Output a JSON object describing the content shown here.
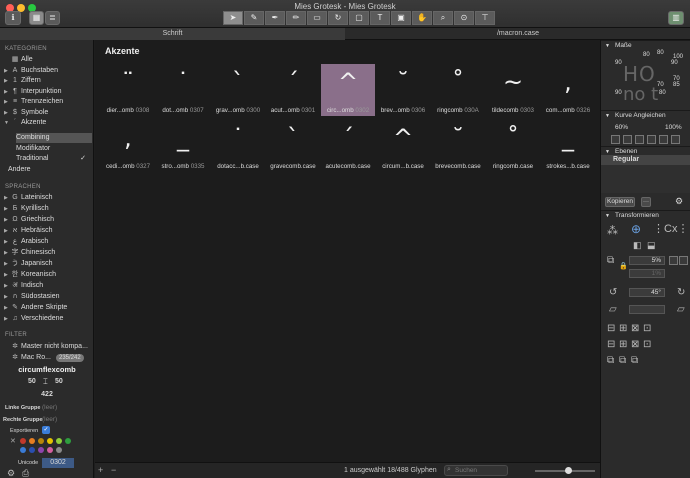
{
  "window": {
    "title": "Mies Grotesk - Mies Grotesk",
    "tab_left": "Schrift",
    "tab_right": "/macron.case"
  },
  "sidebar": {
    "section_categories": "KATEGORIEN",
    "categories": [
      {
        "label": "Alle",
        "icon": "▦"
      },
      {
        "label": "Buchstaben",
        "icon": "A"
      },
      {
        "label": "Ziffern",
        "icon": "1"
      },
      {
        "label": "Interpunktion",
        "icon": "¶"
      },
      {
        "label": "Trennzeichen",
        "icon": "≡"
      },
      {
        "label": "Symbole",
        "icon": "$"
      },
      {
        "label": "Akzente",
        "icon": "´"
      }
    ],
    "akzente_sub": [
      "Combining",
      "Modifikator",
      "Traditional"
    ],
    "other": "Andere",
    "section_languages": "SPRACHEN",
    "languages": [
      {
        "label": "Lateinisch",
        "icon": "G"
      },
      {
        "label": "Kyrillisch",
        "icon": "Б"
      },
      {
        "label": "Griechisch",
        "icon": "Ω"
      },
      {
        "label": "Hebräisch",
        "icon": "א"
      },
      {
        "label": "Arabisch",
        "icon": "ع"
      },
      {
        "label": "Chinesisch",
        "icon": "字"
      },
      {
        "label": "Japanisch",
        "icon": "う"
      },
      {
        "label": "Koreanisch",
        "icon": "한"
      },
      {
        "label": "Indisch",
        "icon": "अ"
      },
      {
        "label": "Südostasien",
        "icon": "ก"
      },
      {
        "label": "Andere Skripte",
        "icon": "✎"
      },
      {
        "label": "Verschiedene",
        "icon": "♫"
      }
    ],
    "section_filter": "FILTER",
    "filters": [
      {
        "label": "Master nicht kompa...",
        "badge": ""
      },
      {
        "label": "Mac Ro...",
        "badge": "235/242"
      }
    ],
    "glyph_info": {
      "name": "circumflexcomb",
      "lsb": "50",
      "rsb": "50",
      "width": "422",
      "left_group_label": "Linke Gruppe",
      "left_group_value": "(leer)",
      "right_group_label": "Rechte Gruppe",
      "right_group_value": "(leer)",
      "export_label": "Exportieren",
      "unicode_label": "Unicode",
      "unicode_value": "0302"
    },
    "label_colors": [
      "#c0392b",
      "#e67e22",
      "#b8860b",
      "#e6c300",
      "#8ecf3a",
      "#2e9e3e",
      "#3a7bd5",
      "#2a4fb0",
      "#8e44ad",
      "#d35fa0",
      "#8a8a8a"
    ]
  },
  "main": {
    "section_title": "Akzente",
    "row1": [
      {
        "glyph": "¨",
        "name": "dier...omb",
        "code": "0308"
      },
      {
        "glyph": "˙",
        "name": "dot...omb",
        "code": "0307"
      },
      {
        "glyph": "`",
        "name": "grav...omb",
        "code": "0300"
      },
      {
        "glyph": "´",
        "name": "acut...omb",
        "code": "0301"
      },
      {
        "glyph": "^",
        "name": "circ...omb",
        "code": "0302"
      },
      {
        "glyph": "˘",
        "name": "brev...omb",
        "code": "0306"
      },
      {
        "glyph": "˚",
        "name": "ringcomb",
        "code": "030A"
      },
      {
        "glyph": "~",
        "name": "tildecomb",
        "code": "0303"
      },
      {
        "glyph": ",",
        "name": "com...omb",
        "code": "0326"
      }
    ],
    "row2": [
      {
        "glyph": ",",
        "name": "cedi...omb",
        "code": "0327"
      },
      {
        "glyph": "_",
        "name": "stro...omb",
        "code": "0335"
      },
      {
        "glyph": "˙",
        "name": "dotacc...b.case",
        "code": ""
      },
      {
        "glyph": "`",
        "name": "gravecomb.case",
        "code": ""
      },
      {
        "glyph": "´",
        "name": "acutecomb.case",
        "code": ""
      },
      {
        "glyph": "^",
        "name": "circum...b.case",
        "code": ""
      },
      {
        "glyph": "˘",
        "name": "brevecomb.case",
        "code": ""
      },
      {
        "glyph": "˚",
        "name": "ringcomb.case",
        "code": ""
      },
      {
        "glyph": "_",
        "name": "strokes...b.case",
        "code": ""
      }
    ],
    "status": "1 ausgewählt 18/488 Glyphen",
    "search_placeholder": "Suchen"
  },
  "right_panel": {
    "masse_label": "Maße",
    "masse_values": [
      "80",
      "80",
      "100",
      "90",
      "90",
      "70",
      "70",
      "85",
      "90",
      "80"
    ],
    "kurve_label": "Kurve Angleichen",
    "kurve_left": "60%",
    "kurve_right": "100%",
    "ebenen_label": "Ebenen",
    "layer": "Regular",
    "copy_button": "Kopieren",
    "transform_label": "Transformieren",
    "scale_value": "5%",
    "scale_value2": "1%",
    "rotate_value": "45°"
  }
}
